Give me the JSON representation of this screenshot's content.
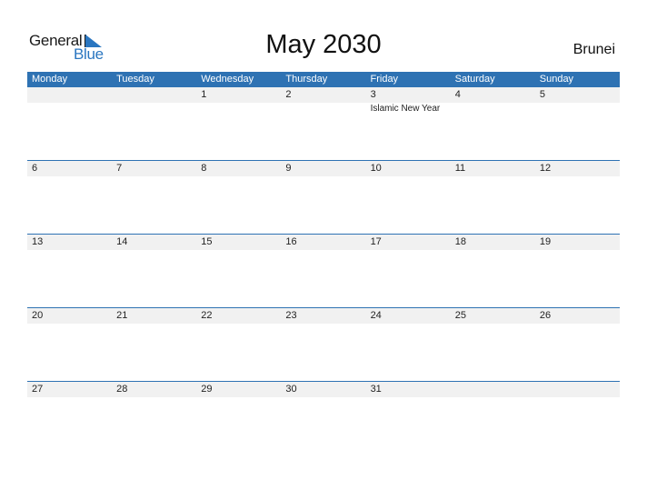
{
  "brand": {
    "word1": "General",
    "word2": "Blue",
    "color": "#2a76c0"
  },
  "title": "May 2030",
  "country": "Brunei",
  "colors": {
    "header_bg": "#2e72b3",
    "band_bg": "#f1f1f1"
  },
  "weekdays": [
    "Monday",
    "Tuesday",
    "Wednesday",
    "Thursday",
    "Friday",
    "Saturday",
    "Sunday"
  ],
  "weeks": [
    {
      "days": [
        {
          "num": "",
          "event": ""
        },
        {
          "num": "",
          "event": ""
        },
        {
          "num": "1",
          "event": ""
        },
        {
          "num": "2",
          "event": ""
        },
        {
          "num": "3",
          "event": "Islamic New Year"
        },
        {
          "num": "4",
          "event": ""
        },
        {
          "num": "5",
          "event": ""
        }
      ]
    },
    {
      "days": [
        {
          "num": "6",
          "event": ""
        },
        {
          "num": "7",
          "event": ""
        },
        {
          "num": "8",
          "event": ""
        },
        {
          "num": "9",
          "event": ""
        },
        {
          "num": "10",
          "event": ""
        },
        {
          "num": "11",
          "event": ""
        },
        {
          "num": "12",
          "event": ""
        }
      ]
    },
    {
      "days": [
        {
          "num": "13",
          "event": ""
        },
        {
          "num": "14",
          "event": ""
        },
        {
          "num": "15",
          "event": ""
        },
        {
          "num": "16",
          "event": ""
        },
        {
          "num": "17",
          "event": ""
        },
        {
          "num": "18",
          "event": ""
        },
        {
          "num": "19",
          "event": ""
        }
      ]
    },
    {
      "days": [
        {
          "num": "20",
          "event": ""
        },
        {
          "num": "21",
          "event": ""
        },
        {
          "num": "22",
          "event": ""
        },
        {
          "num": "23",
          "event": ""
        },
        {
          "num": "24",
          "event": ""
        },
        {
          "num": "25",
          "event": ""
        },
        {
          "num": "26",
          "event": ""
        }
      ]
    },
    {
      "days": [
        {
          "num": "27",
          "event": ""
        },
        {
          "num": "28",
          "event": ""
        },
        {
          "num": "29",
          "event": ""
        },
        {
          "num": "30",
          "event": ""
        },
        {
          "num": "31",
          "event": ""
        },
        {
          "num": "",
          "event": ""
        },
        {
          "num": "",
          "event": ""
        }
      ]
    }
  ]
}
